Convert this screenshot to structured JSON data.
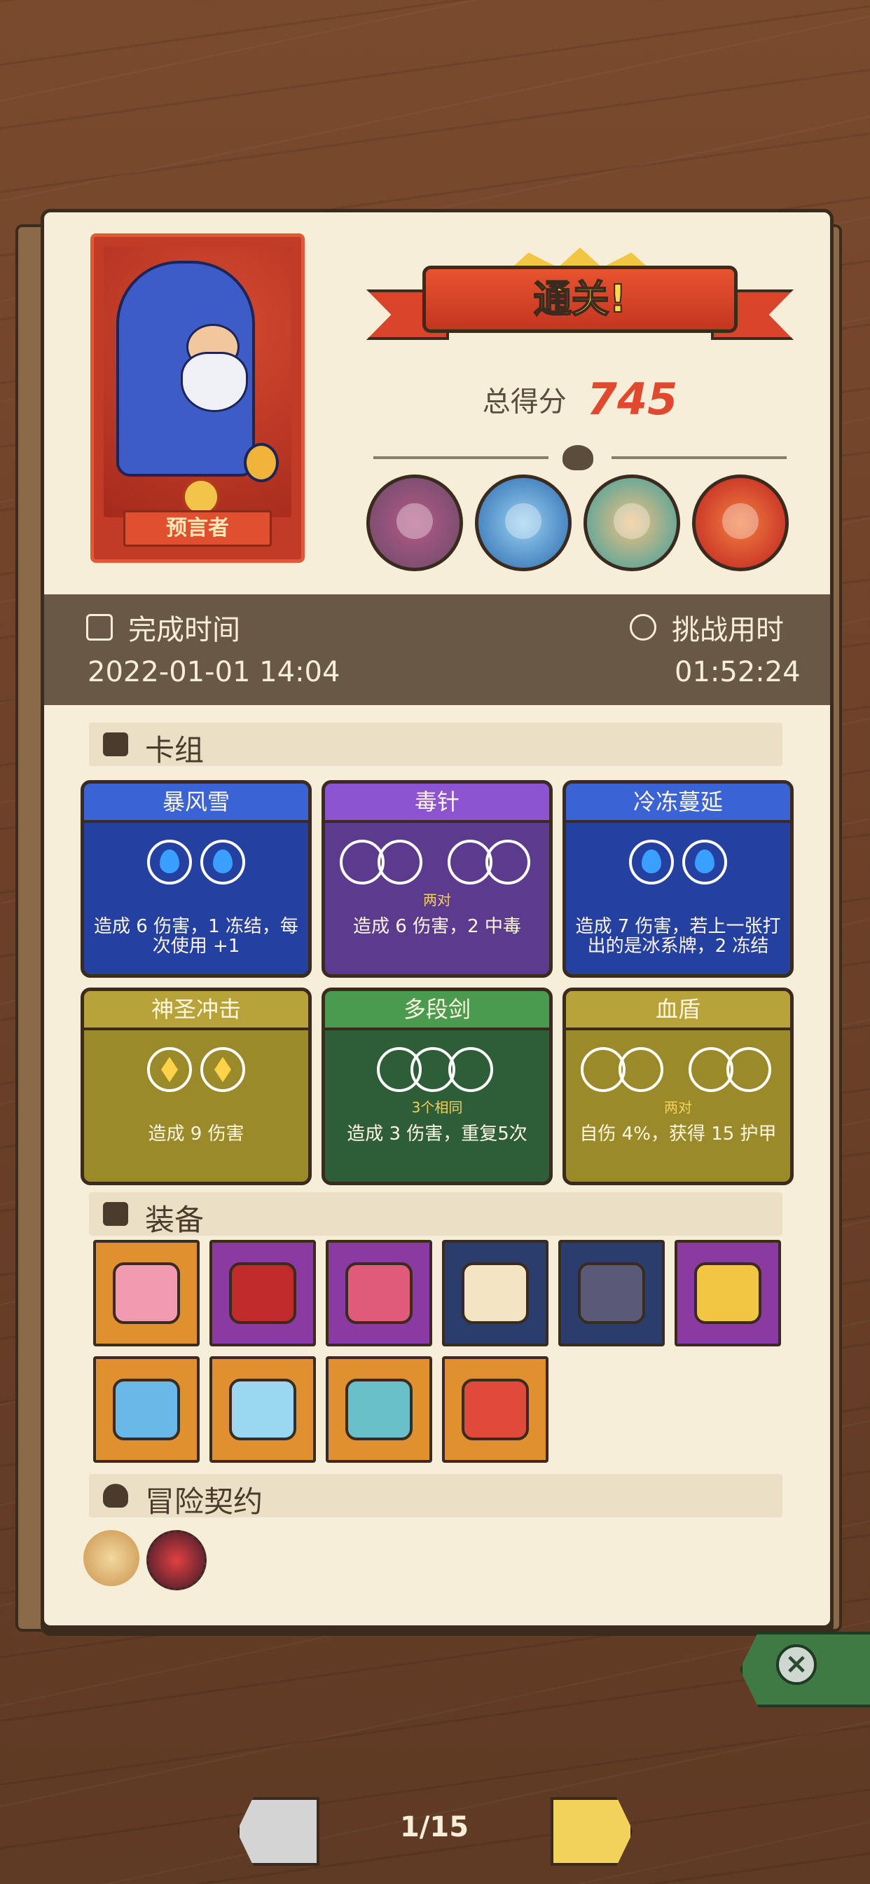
{
  "hero": {
    "name": "预言者"
  },
  "banner": {
    "title": "通关!"
  },
  "score": {
    "label": "总得分",
    "value": "745"
  },
  "stats": {
    "completion_label": "完成时间",
    "completion_value": "2022-01-01 14:04",
    "challenge_label": "挑战用时",
    "challenge_value": "01:52:24"
  },
  "deck": {
    "title": "卡组",
    "cards": [
      {
        "name": "暴风雪",
        "desc": "造成 6 伤害，1 冻结，每次使用 +1",
        "color": "#2440a0",
        "head": "#3a63d6"
      },
      {
        "name": "毒针",
        "note": "两对",
        "desc": "造成 6 伤害，2 中毒",
        "color": "#5c3b8e",
        "head": "#8c54d0"
      },
      {
        "name": "冷冻蔓延",
        "desc": "造成 7 伤害，若上一张打出的是冰系牌，2 冻结",
        "color": "#2440a0",
        "head": "#3a63d6"
      },
      {
        "name": "神圣冲击",
        "desc": "造成 9 伤害",
        "color": "#9a8a2a",
        "head": "#b8a33a"
      },
      {
        "name": "多段剑",
        "note": "3个相同",
        "desc": "造成 3 伤害，重复5次",
        "color": "#2e5e38",
        "head": "#4a9a50"
      },
      {
        "name": "血盾",
        "note": "两对",
        "desc": "自伤 4%，获得 15 护甲",
        "color": "#9a8a2a",
        "head": "#b8a33a"
      }
    ]
  },
  "equipment": {
    "title": "装备",
    "items": [
      {
        "icon": "heart-box-icon",
        "bg": "#e0902e"
      },
      {
        "icon": "red-bowl-icon",
        "bg": "#8a3aa0"
      },
      {
        "icon": "spotted-egg-icon",
        "bg": "#8a3aa0"
      },
      {
        "icon": "scroll-icon",
        "bg": "#2a3e6e"
      },
      {
        "icon": "dark-crystal-icon",
        "bg": "#2a3e6e"
      },
      {
        "icon": "crescent-moon-icon",
        "bg": "#8a3aa0"
      },
      {
        "icon": "ice-shield-icon",
        "bg": "#e0902e"
      },
      {
        "icon": "ghost-slime-icon",
        "bg": "#e0902e"
      },
      {
        "icon": "blue-vase-icon",
        "bg": "#e0902e"
      },
      {
        "icon": "patchwork-cloth-icon",
        "bg": "#e0902e"
      }
    ]
  },
  "contract": {
    "title": "冒险契约",
    "items": [
      {
        "icon": "parchment-scroll-icon"
      },
      {
        "icon": "demon-seal-icon"
      }
    ]
  },
  "navigation": {
    "page": "1/15"
  }
}
